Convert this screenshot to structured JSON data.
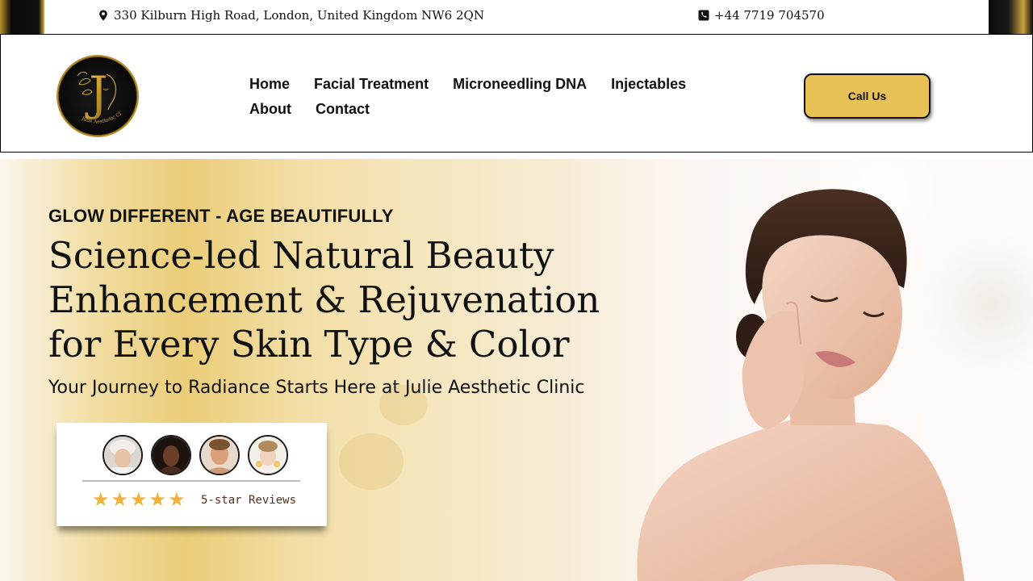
{
  "topbar": {
    "address": "330 Kilburn High Road, London, United Kingdom NW6 2QN",
    "address_icon": "map-pin-icon",
    "phone": "+44 7719 704570",
    "phone_icon": "phone-square-icon"
  },
  "header": {
    "logo_letter": "J",
    "logo_text": "Julie Aesthetic Clinic",
    "nav": {
      "row1": [
        "Home",
        "Facial Treatment",
        "Microneedling DNA",
        "Injectables"
      ],
      "row2": [
        "About",
        "Contact"
      ]
    },
    "cta_label": "Call Us"
  },
  "hero": {
    "eyebrow": "GLOW DIFFERENT - AGE BEAUTIFULLY",
    "headline_lines": [
      "Science-led Natural Beauty",
      "Enhancement & Rejuvenation",
      "for Every Skin Type & Color"
    ],
    "subline": "Your Journey to Radiance Starts Here at Julie Aesthetic Clinic",
    "reviews": {
      "stars": 5,
      "label": "5-star Reviews"
    }
  },
  "colors": {
    "accent_gold": "#e9c257",
    "star_gold": "#f2b13a",
    "text_dark": "#111111"
  }
}
